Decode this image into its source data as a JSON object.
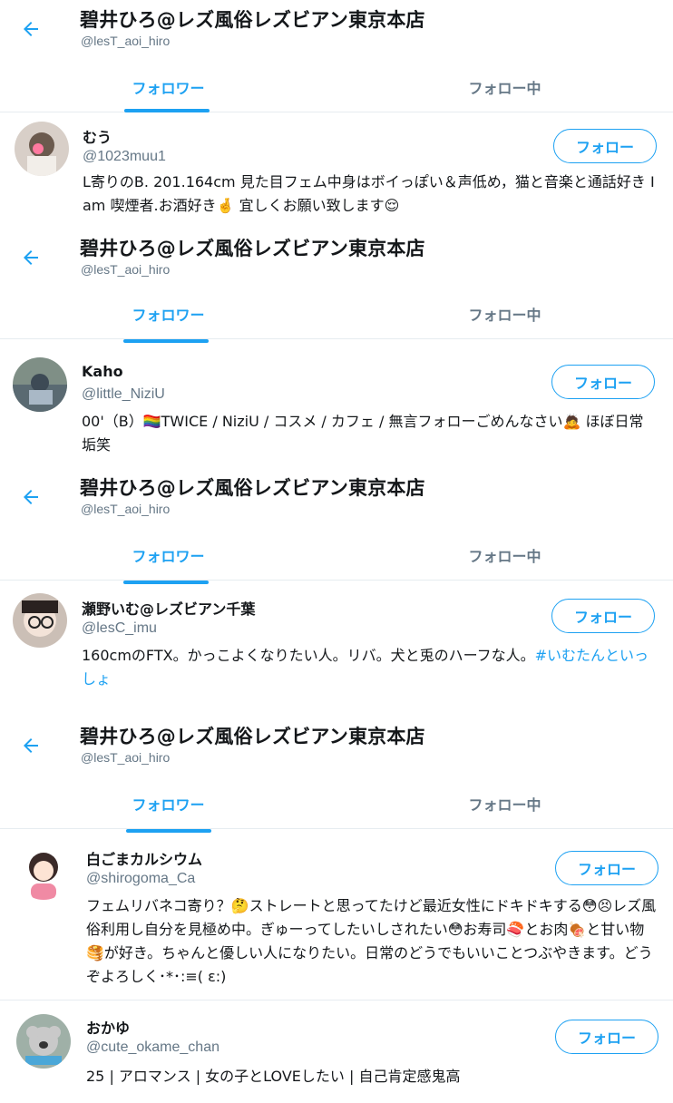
{
  "sections": [
    {
      "header": {
        "title": "碧井ひろ@レズ風俗レズビアン東京本店",
        "handle": "@lesT_aoi_hiro"
      },
      "tabs": {
        "followers": "フォロワー",
        "following": "フォロー中"
      },
      "user": {
        "name": "むう",
        "handle": "@1023muu1",
        "follow_label": "フォロー",
        "bio": "L寄りのB. 201.164cm 見た目フェム中身はボイっぽい＆声低め，猫と音楽と通話好き I am 喫煙者.お酒好き🤞 宜しくお願い致します😌"
      }
    },
    {
      "header": {
        "title": "碧井ひろ@レズ風俗レズビアン東京本店",
        "handle": "@lesT_aoi_hiro"
      },
      "tabs": {
        "followers": "フォロワー",
        "following": "フォロー中"
      },
      "user": {
        "name": "Kaho",
        "handle": "@little_NiziU",
        "follow_label": "フォロー",
        "bio": "00'（B）🏳️‍🌈TWICE / NiziU / コスメ / カフェ / 無言フォローごめんなさい🙇 ほぼ日常垢笑"
      }
    },
    {
      "header": {
        "title": "碧井ひろ@レズ風俗レズビアン東京本店",
        "handle": "@lesT_aoi_hiro"
      },
      "tabs": {
        "followers": "フォロワー",
        "following": "フォロー中"
      },
      "user": {
        "name": "瀬野いむ@レズビアン千葉",
        "handle": "@lesC_imu",
        "follow_label": "フォロー",
        "bio_text": "160cmのFTX。かっこよくなりたい人。リバ。犬と兎のハーフな人。",
        "bio_hashtag": "#いむたんといっしょ"
      }
    },
    {
      "header": {
        "title": "碧井ひろ@レズ風俗レズビアン東京本店",
        "handle": "@lesT_aoi_hiro"
      },
      "tabs": {
        "followers": "フォロワー",
        "following": "フォロー中"
      },
      "user": {
        "name": "白ごまカルシウム",
        "handle": "@shirogoma_Ca",
        "follow_label": "フォロー",
        "bio": "フェムリバネコ寄り？🤔ストレートと思ってたけど最近女性にドキドキする😳😣レズ風俗利用し自分を見極め中。ぎゅーってしたいしされたい😳お寿司🍣とお肉🍖と甘い物🥞が好き。ちゃんと優しい人になりたい。日常のどうでもいいことつぶやきます。どうぞよろしく･*･:≡( ε:)"
      }
    }
  ],
  "last_user": {
    "name": "おかゆ",
    "handle": "@cute_okame_chan",
    "follow_label": "フォロー",
    "bio": "25 | アロマンス | 女の子とLOVEしたい | 自己肯定感鬼高"
  },
  "colors": {
    "accent": "#1da1f2",
    "muted": "#657786",
    "text": "#14171a",
    "border": "#e6ecf0"
  }
}
